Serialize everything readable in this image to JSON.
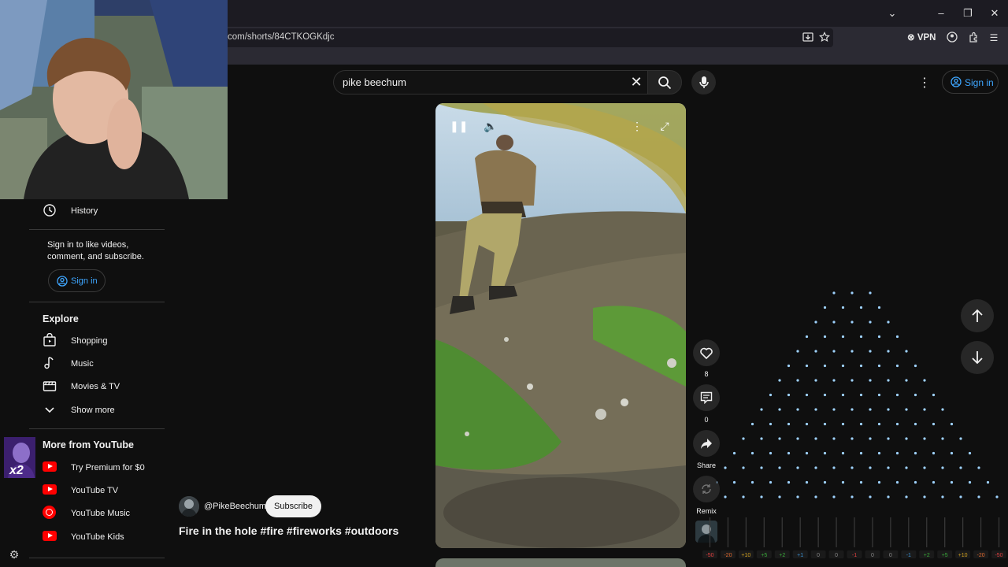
{
  "browser": {
    "url": "com/shorts/84CTKOGKdjc",
    "vpn_label": "VPN"
  },
  "search": {
    "query": "pike beechum"
  },
  "header": {
    "sign_in_label": "Sign in"
  },
  "sidebar": {
    "history_label": "History",
    "signin_prompt_line1": "Sign in to like videos,",
    "signin_prompt_line2": "comment, and subscribe.",
    "signin_button_label": "Sign in",
    "explore_heading": "Explore",
    "explore_items": [
      {
        "label": "Shopping",
        "icon": "shopping-bag-icon"
      },
      {
        "label": "Music",
        "icon": "music-note-icon"
      },
      {
        "label": "Movies & TV",
        "icon": "clapperboard-icon"
      },
      {
        "label": "Show more",
        "icon": "chevron-down-icon"
      }
    ],
    "more_heading": "More from YouTube",
    "more_items": [
      {
        "label": "Try Premium for $0",
        "icon": "youtube-premium-icon"
      },
      {
        "label": "YouTube TV",
        "icon": "youtube-tv-icon"
      },
      {
        "label": "YouTube Music",
        "icon": "youtube-music-icon"
      },
      {
        "label": "YouTube Kids",
        "icon": "youtube-kids-icon"
      }
    ]
  },
  "overlay": {
    "multiplier": "x2"
  },
  "short": {
    "channel_handle": "@PikeBeechum",
    "subscribe_label": "Subscribe",
    "title": "Fire in the hole #fire #fireworks #outdoors"
  },
  "actions": {
    "like_count": "8",
    "comment_count": "0",
    "share_label": "Share",
    "remix_label": "Remix"
  },
  "meter": {
    "labels": [
      "-50",
      "-20",
      "+10",
      "+5",
      "+2",
      "+1",
      "0",
      "0",
      "-1",
      "0",
      "0",
      "-1",
      "+2",
      "+5",
      "+10",
      "-20",
      "-50"
    ],
    "colors": [
      "#e04040",
      "#e06a30",
      "#d0a020",
      "#3aa83a",
      "#3aa83a",
      "#3a8fd0",
      "#888888",
      "#888888",
      "#e04040",
      "#888888",
      "#888888",
      "#3a8fd0",
      "#3aa83a",
      "#3aa83a",
      "#d0a020",
      "#e06a30",
      "#e04040"
    ]
  },
  "colors": {
    "accent": "#3ea6ff",
    "brand_red": "#ff0000",
    "background": "#0f0f0f"
  }
}
